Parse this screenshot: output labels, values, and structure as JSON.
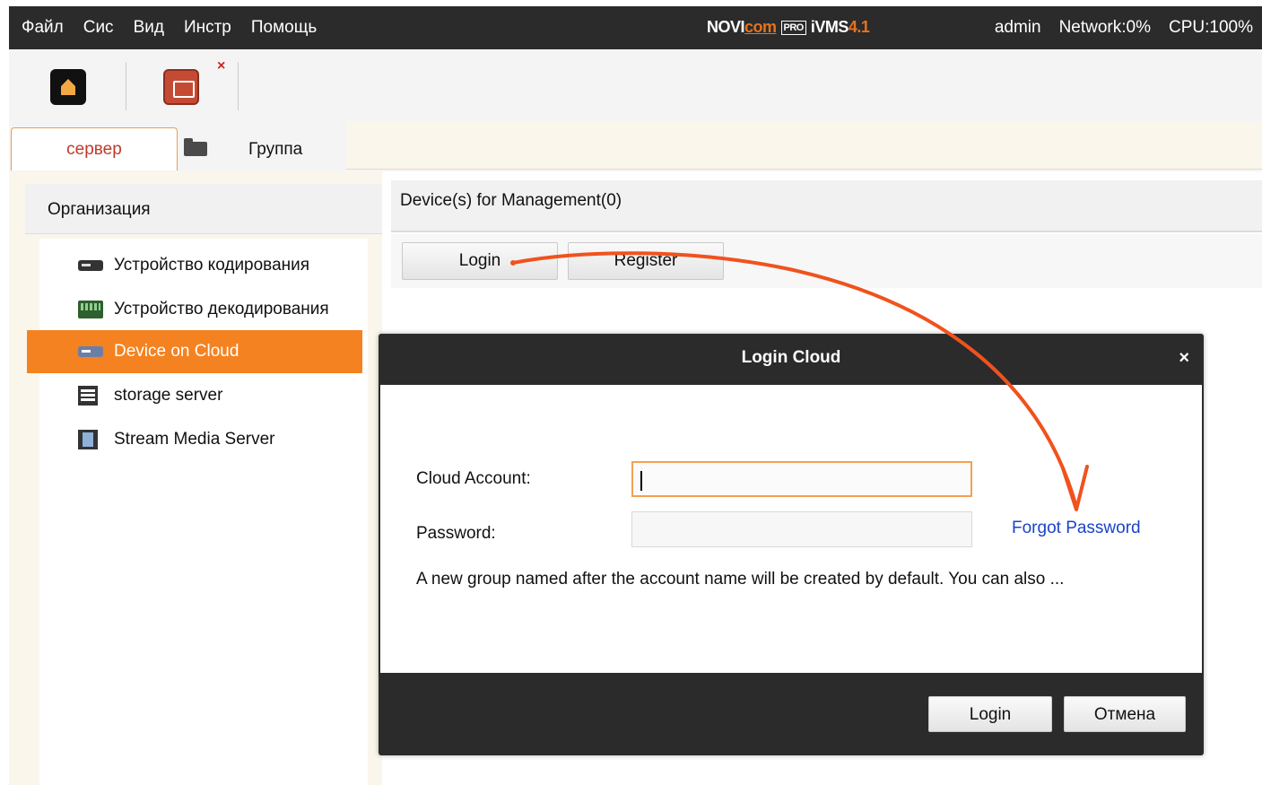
{
  "menubar": {
    "items": [
      "Файл",
      "Сис",
      "Вид",
      "Инстр",
      "Помощь"
    ],
    "logo": {
      "part1": "NOVI",
      "part2": "com",
      "part3": "PRO",
      "part4": "iVMS",
      "part5": "4.1"
    },
    "user": "admin",
    "network": "Network:0%",
    "cpu": "CPU:100%"
  },
  "toolbar": {
    "home_icon": "home-icon",
    "device_icon": "device-management-icon",
    "close_mark": "×"
  },
  "tabs": {
    "server": "сервер",
    "group": "Группа"
  },
  "left_panel": {
    "title": "Организация",
    "items": [
      {
        "label": "Устройство кодирования",
        "icon": "encoder-device-icon"
      },
      {
        "label": "Устройство декодирования",
        "icon": "decoder-device-icon"
      },
      {
        "label": "Device on Cloud",
        "icon": "cloud-device-icon",
        "selected": true
      },
      {
        "label": "storage server",
        "icon": "storage-server-icon"
      },
      {
        "label": "Stream Media Server",
        "icon": "stream-media-server-icon"
      }
    ]
  },
  "main": {
    "title": "Device(s) for Management(0)",
    "login_button": "Login",
    "register_button": "Register"
  },
  "dialog": {
    "title": "Login Cloud",
    "close": "×",
    "account_label": "Cloud Account:",
    "account_value": "",
    "password_label": "Password:",
    "password_value": "",
    "forgot_link": "Forgot Password",
    "hint": "A new group named after the account name will be created  by default. You can also ...",
    "login_button": "Login",
    "cancel_button": "Отмена"
  },
  "colors": {
    "accent": "#f58220",
    "menubar_bg": "#2b2b2b",
    "link": "#1a44c8",
    "annotation_arrow": "#f0521e"
  }
}
